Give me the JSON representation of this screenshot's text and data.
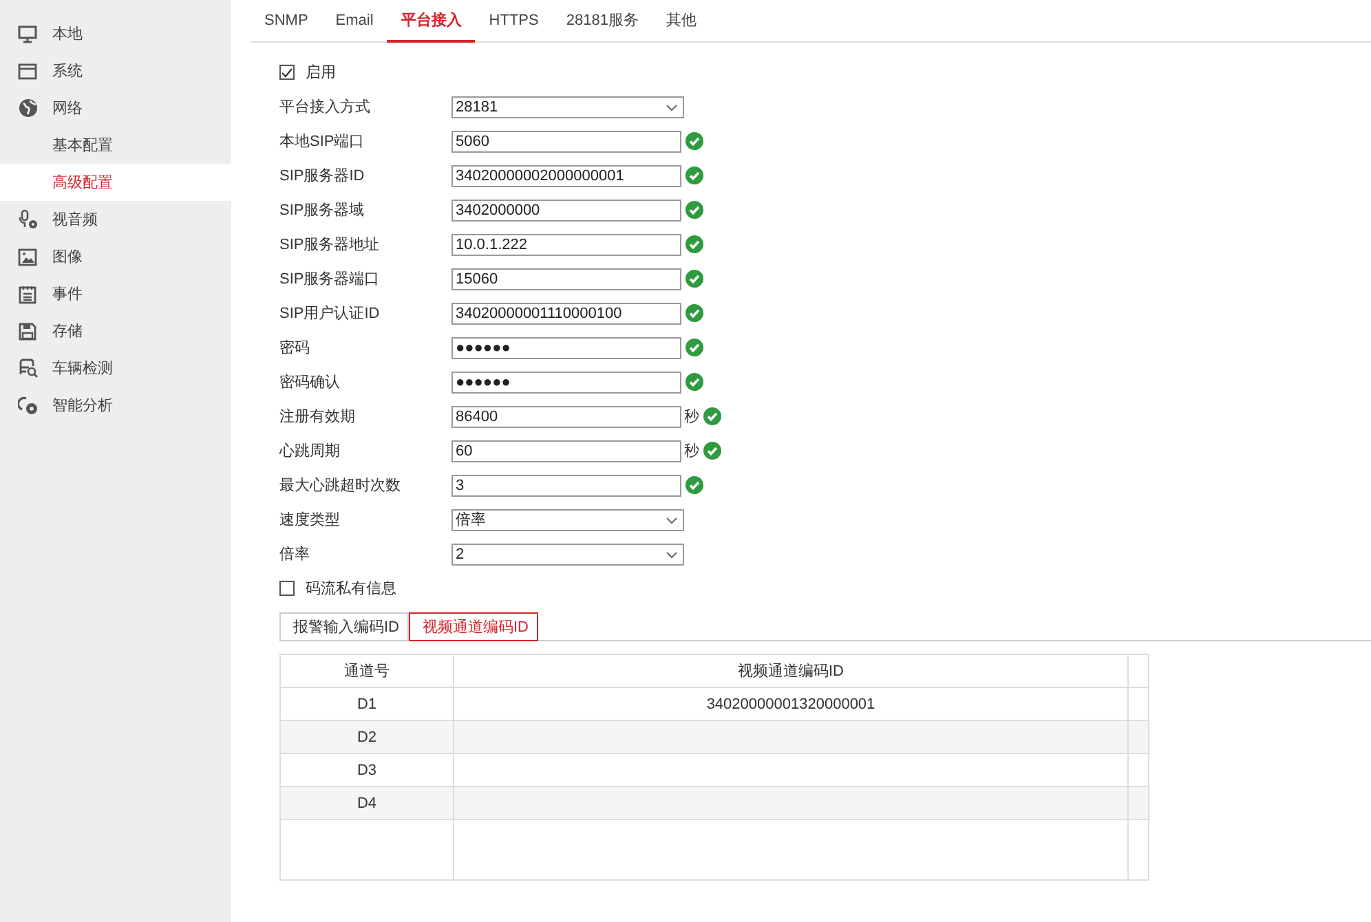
{
  "sidebar": {
    "items": [
      {
        "label": "本地",
        "selected": false
      },
      {
        "label": "系统",
        "selected": false
      },
      {
        "label": "网络",
        "selected": false,
        "children": [
          {
            "label": "基本配置",
            "selected": false
          },
          {
            "label": "高级配置",
            "selected": true
          }
        ]
      },
      {
        "label": "视音频",
        "selected": false
      },
      {
        "label": "图像",
        "selected": false
      },
      {
        "label": "事件",
        "selected": false
      },
      {
        "label": "存储",
        "selected": false
      },
      {
        "label": "车辆检测",
        "selected": false
      },
      {
        "label": "智能分析",
        "selected": false
      }
    ]
  },
  "tabs": [
    {
      "label": "SNMP",
      "selected": false
    },
    {
      "label": "Email",
      "selected": false
    },
    {
      "label": "平台接入",
      "selected": true
    },
    {
      "label": "HTTPS",
      "selected": false
    },
    {
      "label": "28181服务",
      "selected": false
    },
    {
      "label": "其他",
      "selected": false
    }
  ],
  "form": {
    "fields": [
      {
        "kind": "checkbox",
        "label": "启用",
        "checked": true
      },
      {
        "kind": "select",
        "label": "平台接入方式",
        "value": "28181"
      },
      {
        "kind": "text",
        "label": "本地SIP端口",
        "value": "5060",
        "valid": true
      },
      {
        "kind": "text",
        "label": "SIP服务器ID",
        "value": "34020000002000000001",
        "valid": true
      },
      {
        "kind": "text",
        "label": "SIP服务器域",
        "value": "3402000000",
        "valid": true
      },
      {
        "kind": "text",
        "label": "SIP服务器地址",
        "value": "10.0.1.222",
        "valid": true
      },
      {
        "kind": "text",
        "label": "SIP服务器端口",
        "value": "15060",
        "valid": true
      },
      {
        "kind": "text",
        "label": "SIP用户认证ID",
        "value": "34020000001110000100",
        "valid": true
      },
      {
        "kind": "text",
        "label": "密码",
        "value": "●●●●●●",
        "valid": true
      },
      {
        "kind": "text",
        "label": "密码确认",
        "value": "●●●●●●",
        "valid": true
      },
      {
        "kind": "text",
        "label": "注册有效期",
        "value": "86400",
        "unit": "秒",
        "valid": true
      },
      {
        "kind": "text",
        "label": "心跳周期",
        "value": "60",
        "unit": "秒",
        "valid": true
      },
      {
        "kind": "text",
        "label": "最大心跳超时次数",
        "value": "3",
        "valid": true
      },
      {
        "kind": "select",
        "label": "速度类型",
        "value": "倍率"
      },
      {
        "kind": "select",
        "label": "倍率",
        "value": "2"
      },
      {
        "kind": "checkbox",
        "label": "码流私有信息",
        "checked": false
      }
    ]
  },
  "sub_tabs": [
    {
      "label": "报警输入编码ID",
      "selected": false
    },
    {
      "label": "视频通道编码ID",
      "selected": true
    }
  ],
  "table": {
    "columns": [
      "通道号",
      "视频通道编码ID"
    ],
    "rows": [
      [
        "D1",
        "34020000001320000001"
      ],
      [
        "D2",
        ""
      ],
      [
        "D3",
        ""
      ],
      [
        "D4",
        ""
      ]
    ]
  }
}
